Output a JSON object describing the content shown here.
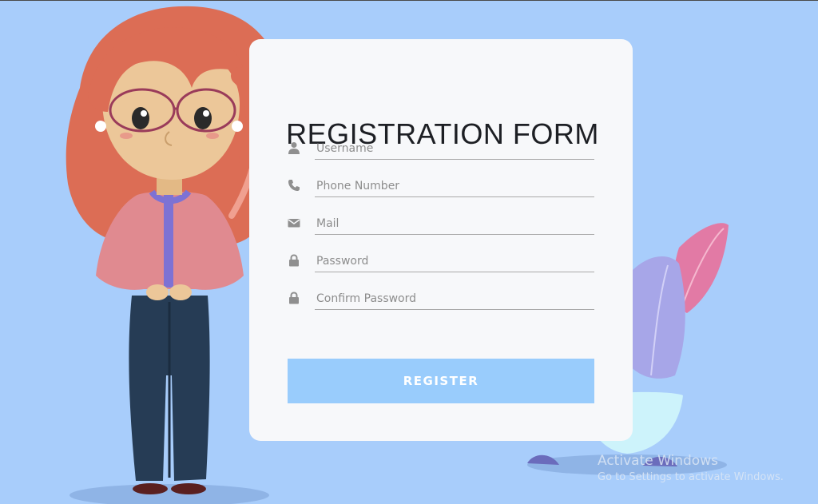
{
  "form": {
    "title": "REGISTRATION FORM",
    "fields": [
      {
        "icon": "user-icon",
        "placeholder": "Username",
        "value": ""
      },
      {
        "icon": "phone-icon",
        "placeholder": "Phone Number",
        "value": ""
      },
      {
        "icon": "mail-icon",
        "placeholder": "Mail",
        "value": ""
      },
      {
        "icon": "lock-icon",
        "placeholder": "Password",
        "value": ""
      },
      {
        "icon": "lock-icon",
        "placeholder": "Confirm Password",
        "value": ""
      }
    ],
    "register_label": "REGISTER"
  },
  "watermark": {
    "title": "Activate Windows",
    "subtitle": "Go to Settings to activate Windows."
  },
  "colors": {
    "background": "#a8cdfb",
    "card": "#f7f8fa",
    "button": "#99ccfc",
    "icon": "#8f8f8f"
  }
}
